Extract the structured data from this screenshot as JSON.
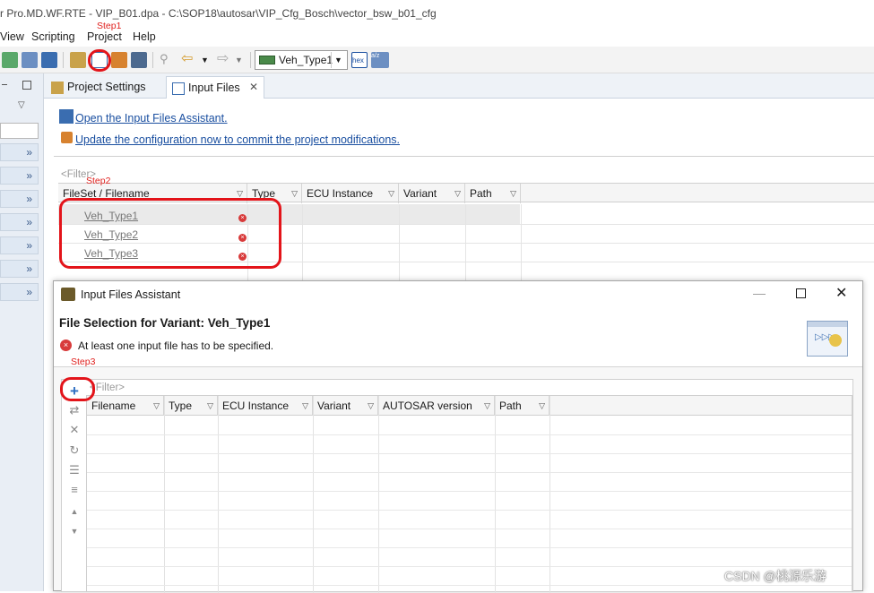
{
  "window": {
    "title": "r Pro.MD.WF.RTE - VIP_B01.dpa - C:\\SOP18\\autosar\\VIP_Cfg_Bosch\\vector_bsw_b01_cfg"
  },
  "menu": [
    "View",
    "Scripting",
    "Project",
    "Help"
  ],
  "annotations": {
    "step1": "Step1",
    "step2": "Step2",
    "step3": "Step3"
  },
  "toolbar": {
    "variant_combo": "Veh_Type1",
    "hex_label": "hex",
    "sort_label": "a/z"
  },
  "tabs": [
    {
      "label": "Project Settings"
    },
    {
      "label": "Input Files"
    }
  ],
  "links": {
    "assistant": "Open the Input Files Assistant.",
    "update": "Update the configuration now to commit the project modifications."
  },
  "main_table": {
    "filter_placeholder": "<Filter>",
    "columns": [
      "FileSet / Filename",
      "Type",
      "ECU Instance",
      "Variant",
      "Path"
    ],
    "rows": [
      "Veh_Type1",
      "Veh_Type2",
      "Veh_Type3"
    ]
  },
  "dialog": {
    "title": "Input Files Assistant",
    "heading": "File Selection for Variant: Veh_Type1",
    "error": "At least one input file has to be specified.",
    "filter_placeholder": "<Filter>",
    "columns": [
      "Filename",
      "Type",
      "ECU Instance",
      "Variant",
      "AUTOSAR version",
      "Path"
    ]
  },
  "watermark": "CSDN @桃源乐游",
  "colors": {
    "annotation_red": "#e3141a",
    "link_blue": "#1a4fa0",
    "error_red": "#d83b3b"
  }
}
